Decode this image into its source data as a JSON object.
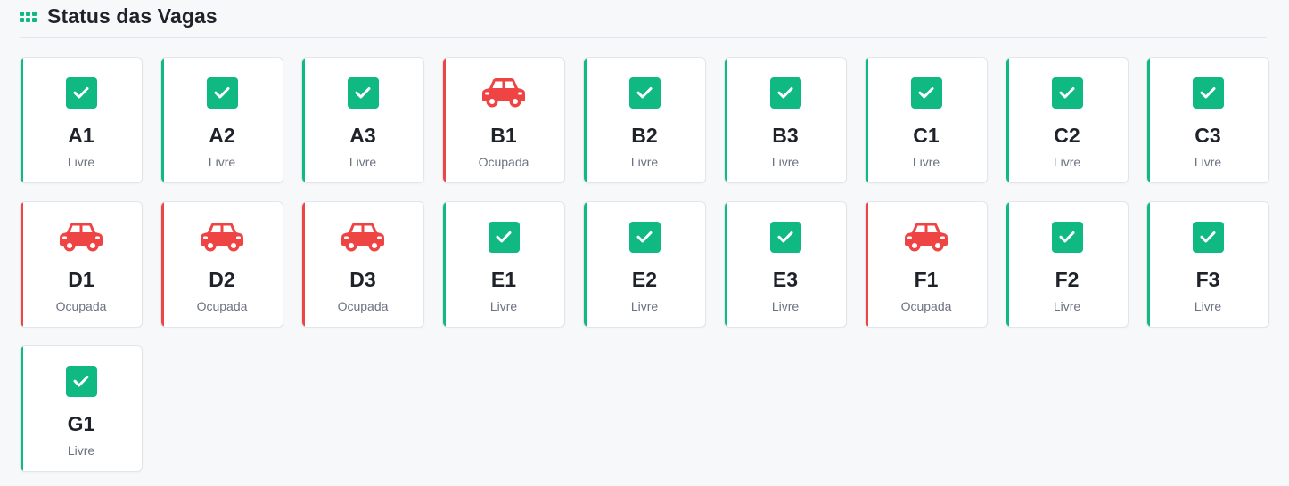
{
  "header": {
    "title": "Status das Vagas",
    "icon": "grid-icon"
  },
  "colors": {
    "free": "#10b981",
    "occupied": "#ef4444"
  },
  "slots": [
    {
      "id": "A1",
      "status": "Livre",
      "occupied": false
    },
    {
      "id": "A2",
      "status": "Livre",
      "occupied": false
    },
    {
      "id": "A3",
      "status": "Livre",
      "occupied": false
    },
    {
      "id": "B1",
      "status": "Ocupada",
      "occupied": true
    },
    {
      "id": "B2",
      "status": "Livre",
      "occupied": false
    },
    {
      "id": "B3",
      "status": "Livre",
      "occupied": false
    },
    {
      "id": "C1",
      "status": "Livre",
      "occupied": false
    },
    {
      "id": "C2",
      "status": "Livre",
      "occupied": false
    },
    {
      "id": "C3",
      "status": "Livre",
      "occupied": false
    },
    {
      "id": "D1",
      "status": "Ocupada",
      "occupied": true
    },
    {
      "id": "D2",
      "status": "Ocupada",
      "occupied": true
    },
    {
      "id": "D3",
      "status": "Ocupada",
      "occupied": true
    },
    {
      "id": "E1",
      "status": "Livre",
      "occupied": false
    },
    {
      "id": "E2",
      "status": "Livre",
      "occupied": false
    },
    {
      "id": "E3",
      "status": "Livre",
      "occupied": false
    },
    {
      "id": "F1",
      "status": "Ocupada",
      "occupied": true
    },
    {
      "id": "F2",
      "status": "Livre",
      "occupied": false
    },
    {
      "id": "F3",
      "status": "Livre",
      "occupied": false
    },
    {
      "id": "G1",
      "status": "Livre",
      "occupied": false
    }
  ]
}
